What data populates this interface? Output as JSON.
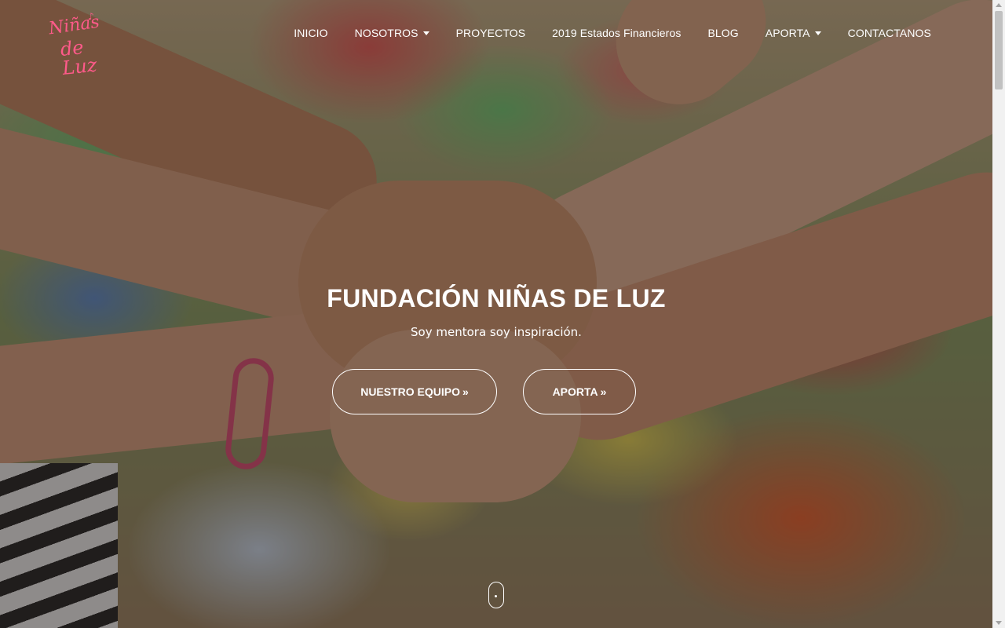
{
  "brand": {
    "logo_line1": "Niñas",
    "logo_line2": "de Luz",
    "logo_color": "#ff5a8a"
  },
  "nav": {
    "items": [
      {
        "label": "INICIO",
        "dropdown": false
      },
      {
        "label": "NOSOTROS",
        "dropdown": true
      },
      {
        "label": "PROYECTOS",
        "dropdown": false
      },
      {
        "label": "2019 Estados Financieros",
        "dropdown": false
      },
      {
        "label": "BLOG",
        "dropdown": false
      },
      {
        "label": "APORTA",
        "dropdown": true
      },
      {
        "label": "CONTACTANOS",
        "dropdown": false
      }
    ]
  },
  "hero": {
    "title": "FUNDACIÓN NIÑAS DE LUZ",
    "subtitle": "Soy mentora soy inspiración.",
    "buttons": {
      "team_label": "NUESTRO EQUIPO",
      "aporta_label": "APORTA",
      "arrow_icon": "»"
    }
  },
  "colors": {
    "text": "#ffffff",
    "bracelet": "#e0527a"
  }
}
